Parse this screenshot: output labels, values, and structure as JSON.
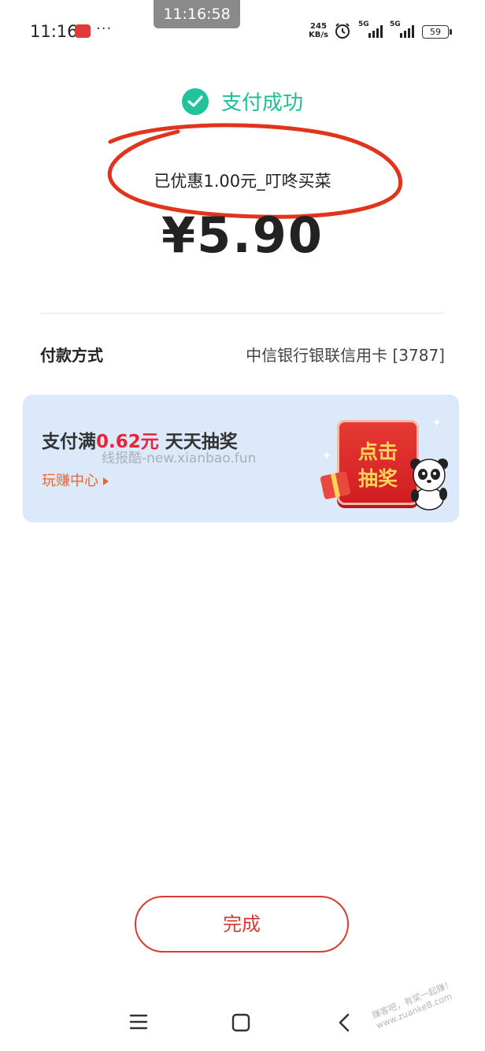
{
  "status_bar": {
    "time": "11:16",
    "pill_time": "11:16:58",
    "more": "···",
    "speed_value": "245",
    "speed_unit": "KB/s",
    "net1": "5G",
    "net2": "5G",
    "battery": "59",
    "icons": [
      "app-notification-icon",
      "alarm-icon",
      "signal-icon",
      "battery-icon"
    ]
  },
  "result": {
    "title": "支付成功",
    "discount": "已优惠1.00元_叮咚买菜",
    "amount": "¥5.90"
  },
  "payment": {
    "label": "付款方式",
    "value": "中信银行银联信用卡 [3787]"
  },
  "promo": {
    "title_prefix": "支付满",
    "title_highlight": "0.62元",
    "title_suffix": " 天天抽奖",
    "link": "玩赚中心",
    "button_line1": "点击",
    "button_line2": "抽奖",
    "watermark": "线报酷-new.xianbao.fun"
  },
  "actions": {
    "done": "完成"
  },
  "corner_watermark": {
    "line1": "赚客吧，有奖一起赚！",
    "line2": "www.zuanke8.com"
  },
  "colors": {
    "success": "#22c39a",
    "accent_red": "#d63c36",
    "promo_bg": "#dbe9fb",
    "annotation": "#e0341c"
  }
}
